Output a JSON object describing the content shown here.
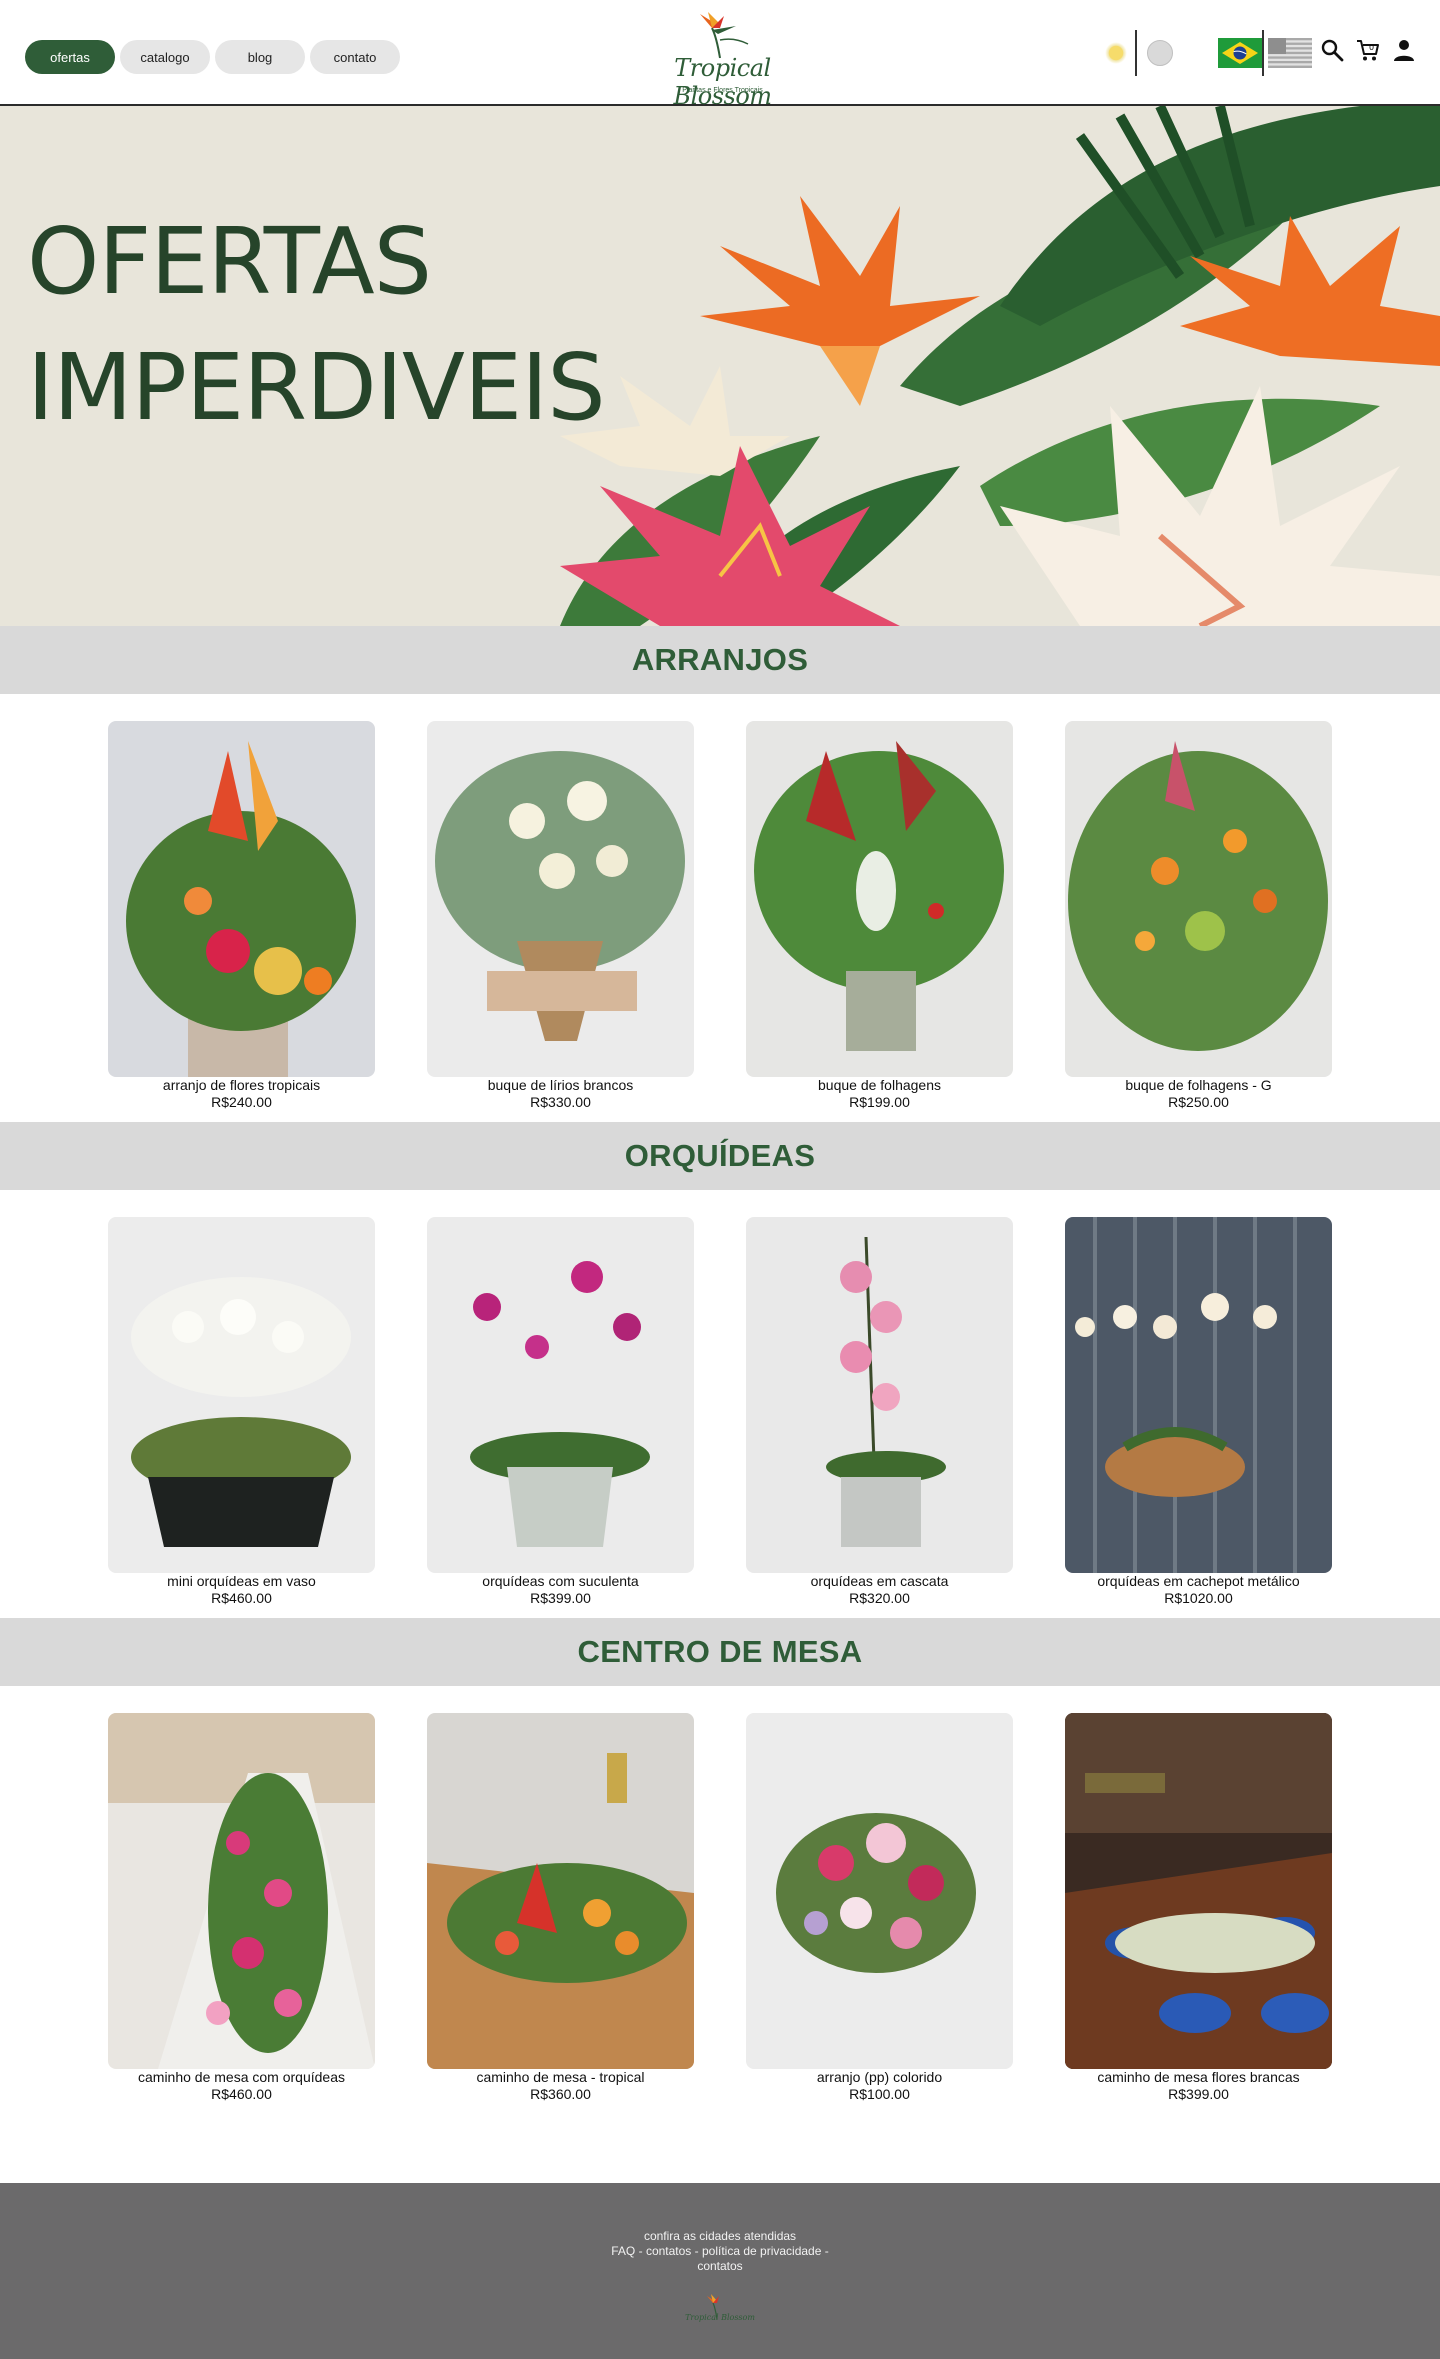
{
  "header": {
    "nav": [
      {
        "label": "ofertas",
        "active": true
      },
      {
        "label": "catalogo",
        "active": false
      },
      {
        "label": "blog",
        "active": false
      },
      {
        "label": "contato",
        "active": false
      }
    ],
    "logo": {
      "name": "Tropical Blossom",
      "tagline": "Plantas e Flores Tropicais"
    },
    "icons": [
      "sun-icon",
      "moon-icon",
      "brazil-flag-icon",
      "usa-flag-icon",
      "search-icon",
      "cart-icon",
      "user-icon"
    ]
  },
  "hero": {
    "line1": "OFERTAS",
    "line2": "IMPERDIVEIS"
  },
  "sections": [
    {
      "title": "ARRANJOS",
      "products": [
        {
          "name": "arranjo de flores tropicais",
          "price": "R$240.00"
        },
        {
          "name": "buque de lírios brancos",
          "price": "R$330.00"
        },
        {
          "name": "buque de folhagens",
          "price": "R$199.00"
        },
        {
          "name": "buque de folhagens - G",
          "price": "R$250.00"
        }
      ]
    },
    {
      "title": "ORQUÍDEAS",
      "products": [
        {
          "name": "mini orquídeas em vaso",
          "price": "R$460.00"
        },
        {
          "name": "orquídeas com suculenta",
          "price": "R$399.00"
        },
        {
          "name": "orquídeas em cascata",
          "price": "R$320.00"
        },
        {
          "name": "orquídeas em cachepot metálico",
          "price": "R$1020.00"
        }
      ]
    },
    {
      "title": "CENTRO DE MESA",
      "products": [
        {
          "name": "caminho de mesa com orquídeas",
          "price": "R$460.00"
        },
        {
          "name": "caminho de mesa - tropical",
          "price": "R$360.00"
        },
        {
          "name": "arranjo (pp) colorido",
          "price": "R$100.00"
        },
        {
          "name": "caminho de mesa flores brancas",
          "price": "R$399.00"
        }
      ]
    }
  ],
  "footer": {
    "cities": "confira as cidades atendidas",
    "links": [
      "FAQ",
      "contatos",
      "política de privacidade"
    ],
    "separator": " - ",
    "last_link": "contatos"
  },
  "colors": {
    "brand_green": "#2f5d38",
    "section_bar": "#d9d9d9",
    "footer_bg": "#6b6a6b"
  }
}
